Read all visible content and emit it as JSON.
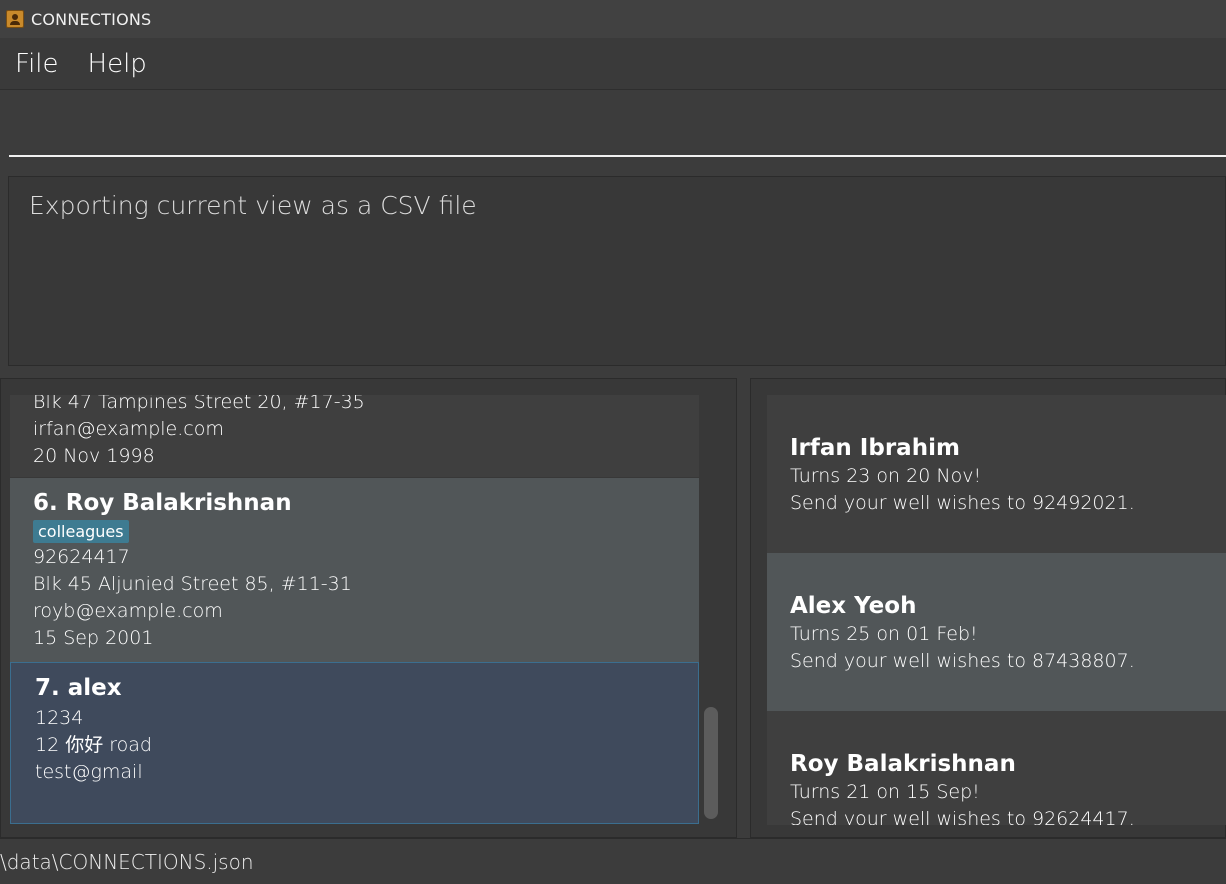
{
  "window": {
    "title": "CONNECTIONS"
  },
  "menu": {
    "file": "File",
    "help": "Help"
  },
  "command": {
    "value": ""
  },
  "result": {
    "text": "Exporting current view as a CSV file"
  },
  "persons": [
    {
      "lines": [
        "Blk 47 Tampines Street 20, #17-35",
        "irfan@example.com",
        "20 Nov 1998"
      ]
    },
    {
      "name": "6.  Roy Balakrishnan",
      "tag": "colleagues",
      "lines": [
        "92624417",
        "Blk 45 Aljunied Street 85, #11-31",
        "royb@example.com",
        "15 Sep 2001"
      ]
    },
    {
      "name": "7.  alex",
      "lines": [
        "1234",
        "12 你好 road",
        "test@gmail"
      ]
    }
  ],
  "birthdays": [
    {
      "name": "Irfan Ibrahim",
      "turns": "Turns 23 on 20 Nov!",
      "wish": "Send your well wishes to 92492021."
    },
    {
      "name": "Alex Yeoh",
      "turns": "Turns 25 on 01 Feb!",
      "wish": "Send your well wishes to 87438807."
    },
    {
      "name": "Roy Balakrishnan",
      "turns": "Turns 21 on 15 Sep!",
      "wish": "Send your well wishes to 92624417."
    }
  ],
  "status": {
    "path": "\\data\\CONNECTIONS.json"
  },
  "colors": {
    "background": "#3c3c3c",
    "card_default": "#3f3f3f",
    "card_alt": "#515658",
    "card_selected": "#3f4a5c",
    "selected_border": "#3b6e8f",
    "tag": "#3e7b91"
  },
  "icons": {
    "app": "contacts-app-icon"
  }
}
